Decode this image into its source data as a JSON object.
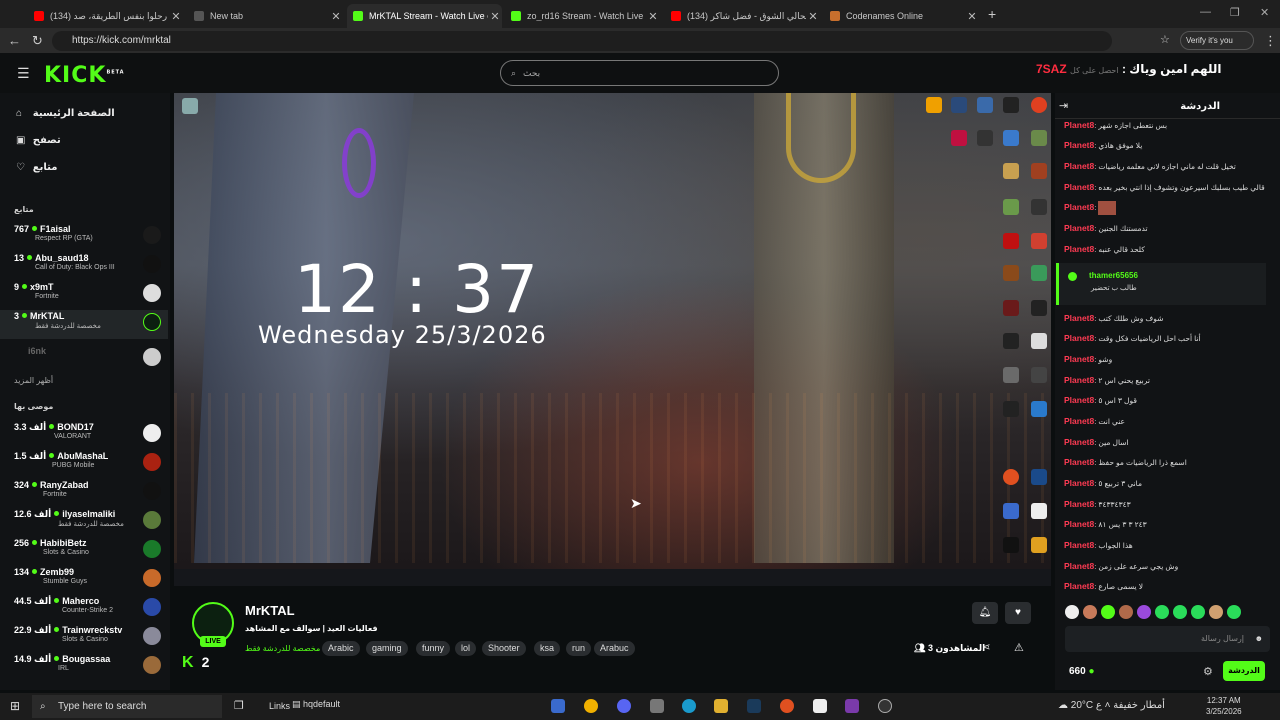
{
  "browser": {
    "tabs": [
      {
        "label": "(134) اربعة رحلوا بنفس الطريقة، صد",
        "favicon_color": "#ff0000"
      },
      {
        "label": "New tab",
        "favicon_color": "#555555"
      },
      {
        "label": "MrKTAL Stream - Watch Live on Ki",
        "favicon_color": "#53fc18",
        "active": true
      },
      {
        "label": "zo_rd16 Stream - Watch Live on Ki",
        "favicon_color": "#53fc18"
      },
      {
        "label": "(134) صحالي الشوق - فضل شاكر - ...",
        "favicon_color": "#ff0000"
      },
      {
        "label": "Codenames Online",
        "favicon_color": "#c76f2d"
      }
    ],
    "url": "https://kick.com/mrktal",
    "verify_label": "Verify it's you"
  },
  "header": {
    "logo": "KICK",
    "logo_sup": "BETA",
    "search_placeholder": "بحث",
    "promo_text": "اللهم امين وياك : ",
    "promo_code": "7SAZ",
    "promo_small": "احصل على كل"
  },
  "sidebar": {
    "nav": [
      {
        "label": "الصفحة الرئيسية",
        "icon": "home-icon"
      },
      {
        "label": "تصفح",
        "icon": "browse-icon"
      },
      {
        "label": "متابع",
        "icon": "heart-icon"
      }
    ],
    "following_title": "متابع",
    "following": [
      {
        "count": "767",
        "name": "F1aisal",
        "sub": "Respect RP (GTA)"
      },
      {
        "count": "13",
        "name": "Abu_saud18",
        "sub": "Call of Duty: Black Ops III"
      },
      {
        "count": "9",
        "name": "x9mT",
        "sub": "Fortnite"
      },
      {
        "count": "3",
        "name": "MrKTAL",
        "sub": "مخصصة للدردشة فقط"
      }
    ],
    "offline_name": "i6nk",
    "show_more": "أظهر المزيد",
    "recommended_title": "موصى بها",
    "recommended": [
      {
        "count": "3.3 ألف",
        "name": "BOND17",
        "sub": "VALORANT"
      },
      {
        "count": "1.5 ألف",
        "name": "AbuMashaL",
        "sub": "PUBG Mobile"
      },
      {
        "count": "324",
        "name": "RanyZabad",
        "sub": "Fortnite"
      },
      {
        "count": "12.6 ألف",
        "name": "ilyaselmaliki",
        "sub": "مخصصة للدردشة فقط"
      },
      {
        "count": "256",
        "name": "HabibiBetz",
        "sub": "Slots & Casino"
      },
      {
        "count": "134",
        "name": "Zemb99",
        "sub": "Stumble Guys"
      },
      {
        "count": "44.5 ألف",
        "name": "Maherco",
        "sub": "Counter-Strike 2"
      },
      {
        "count": "22.9 ألف",
        "name": "Trainwreckstv",
        "sub": "Slots & Casino"
      },
      {
        "count": "14.9 ألف",
        "name": "Bougassaa",
        "sub": "IRL"
      }
    ]
  },
  "video": {
    "clock": "12 : 37",
    "date": "Wednesday  25/3/2026"
  },
  "stream": {
    "name": "MrKTAL",
    "title": "فعاليات العيد | سوالف مع المشاهد",
    "category": "مخصصة للدردشة فقط",
    "live": "LIVE",
    "tags": [
      "Arabic",
      "gaming",
      "funny",
      "lol",
      "Shooter",
      "ksa",
      "run",
      "Arabuc"
    ],
    "viewers": "3 المشاهدون",
    "kick_two": "2"
  },
  "chat": {
    "title": "الدردشة",
    "messages": [
      {
        "user": "Planet8",
        "text": "بس نتعطى اجازه شهر"
      },
      {
        "user": "Planet8",
        "text": "يلا موفق هاذي"
      },
      {
        "user": "Planet8",
        "text": "تخيل قلت له ماني اجازه لاني معلمه رياضيات"
      },
      {
        "user": "Planet8",
        "text": "قالي طيب بسلبك اسيرعون وتشوف إذا انتي بخير بعده"
      },
      {
        "user": "Planet8",
        "text": ""
      },
      {
        "user": "Planet8",
        "text": "تدمستنك الجنين"
      },
      {
        "user": "Planet8",
        "text": "كلحد قالي عنبه"
      },
      {
        "user": "Planet8",
        "text": "شوف وش طلك كتب"
      },
      {
        "user": "Planet8",
        "text": "أنا أحب احل الرياضيات فكل وقت"
      },
      {
        "user": "Planet8",
        "text": "وشو"
      },
      {
        "user": "Planet8",
        "text": "تربيع يحني اس ٢"
      },
      {
        "user": "Planet8",
        "text": "قول ٣ اس ٥"
      },
      {
        "user": "Planet8",
        "text": "عني انت"
      },
      {
        "user": "Planet8",
        "text": "اسال مين"
      },
      {
        "user": "Planet8",
        "text": "اسمع ذرا الرياضيات مو حفظ"
      },
      {
        "user": "Planet8",
        "text": "ماني ٣ تربيع ٥"
      },
      {
        "user": "Planet8",
        "text": "٣٤٣٣٤٣٤٣"
      },
      {
        "user": "Planet8",
        "text": "٢٤٣ ٣ ٣ يس ٨١"
      },
      {
        "user": "Planet8",
        "text": "هذا الجواب"
      },
      {
        "user": "Planet8",
        "text": "وش يجي سرعه على زمن"
      },
      {
        "user": "Planet8",
        "text": "لا يسمى صارع"
      }
    ],
    "highlight": {
      "user": "thamer65656",
      "text": "طالب ب تحضير"
    },
    "input_placeholder": "إرسال رسالة",
    "points": "660",
    "send_label": "الدردشة"
  },
  "taskbar": {
    "search": "Type here to search",
    "links": "Links",
    "file": "hqdefault",
    "weather": "20°C  أمطار خفيفة",
    "lang": "ع",
    "time": "12:37 AM",
    "date": "3/25/2026"
  }
}
